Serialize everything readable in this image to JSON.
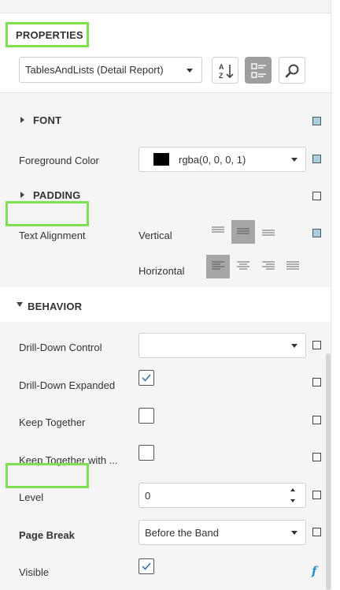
{
  "header": {
    "title": "PROPERTIES",
    "report_select_value": "TablesAndLists (Detail Report)"
  },
  "toolbar": {
    "buttons": [
      {
        "name": "sort-alphabetical-button",
        "icon": "sort-az-icon",
        "active": false
      },
      {
        "name": "categorized-button",
        "icon": "categories-icon",
        "active": true
      },
      {
        "name": "search-button",
        "icon": "search-icon",
        "active": false
      }
    ]
  },
  "appearance": {
    "font_group": "FONT",
    "foreground_color_label": "Foreground Color",
    "foreground_color_value": "rgba(0, 0, 0, 1)",
    "foreground_color_swatch": "#000000",
    "padding_group": "PADDING",
    "text_alignment_label": "Text Alignment",
    "vertical_label": "Vertical",
    "horizontal_label": "Horizontal",
    "vertical_selected": "middle",
    "horizontal_selected": "left"
  },
  "behavior": {
    "group_title": "BEHAVIOR",
    "drill_down_control_label": "Drill-Down Control",
    "drill_down_control_value": "",
    "drill_down_expanded_label": "Drill-Down Expanded",
    "drill_down_expanded_checked": true,
    "keep_together_label": "Keep Together",
    "keep_together_checked": false,
    "keep_together_with_label": "Keep Together with ...",
    "keep_together_with_checked": false,
    "level_label": "Level",
    "level_value": "0",
    "page_break_label": "Page Break",
    "page_break_value": "Before the Band",
    "visible_label": "Visible",
    "visible_checked": true,
    "visible_expression_icon": "f"
  },
  "colors": {
    "highlight": "#7fe052",
    "modified_marker": "#a8cfe0",
    "expression_icon": "#2a8cc9"
  }
}
